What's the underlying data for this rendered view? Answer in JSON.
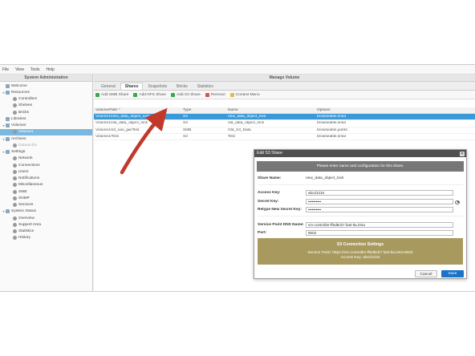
{
  "menu": [
    "File",
    "View",
    "Tools",
    "Help"
  ],
  "sidebar": {
    "title": "System Administration",
    "items": [
      {
        "label": "Welcome",
        "level": 0,
        "tw": ""
      },
      {
        "label": "Resources",
        "level": 0,
        "tw": "▾"
      },
      {
        "label": "Controllers",
        "level": 1,
        "tw": ""
      },
      {
        "label": "Shelves",
        "level": 1,
        "tw": ""
      },
      {
        "label": "Bricks",
        "level": 1,
        "tw": ""
      },
      {
        "label": "Libraries",
        "level": 0,
        "tw": ""
      },
      {
        "label": "Volumes",
        "level": 0,
        "tw": "▾"
      },
      {
        "label": "Volume1",
        "level": 1,
        "tw": "",
        "selected": true
      },
      {
        "label": "Archives",
        "level": 0,
        "tw": "▾"
      },
      {
        "label": "Dataarchiv",
        "level": 1,
        "tw": "",
        "disabled": true
      },
      {
        "label": "Settings",
        "level": 0,
        "tw": "▾"
      },
      {
        "label": "Network",
        "level": 1,
        "tw": ""
      },
      {
        "label": "Connections",
        "level": 1,
        "tw": ""
      },
      {
        "label": "Users",
        "level": 1,
        "tw": ""
      },
      {
        "label": "Notifications",
        "level": 1,
        "tw": ""
      },
      {
        "label": "Miscellaneous",
        "level": 1,
        "tw": ""
      },
      {
        "label": "SMB",
        "level": 1,
        "tw": ""
      },
      {
        "label": "SNMP",
        "level": 1,
        "tw": ""
      },
      {
        "label": "Services",
        "level": 1,
        "tw": ""
      },
      {
        "label": "System Status",
        "level": 0,
        "tw": "▾"
      },
      {
        "label": "Overview",
        "level": 1,
        "tw": ""
      },
      {
        "label": "Support Area",
        "level": 1,
        "tw": ""
      },
      {
        "label": "Statistics",
        "level": 1,
        "tw": ""
      },
      {
        "label": "History",
        "level": 1,
        "tw": ""
      }
    ]
  },
  "main": {
    "title": "Manage Volume",
    "tabs": [
      "General",
      "Shares",
      "Snapshots",
      "Bricks",
      "Statistics"
    ],
    "toolbar": [
      {
        "label": "Add SMB Share",
        "color": "#3aa845"
      },
      {
        "label": "Add NFS Share",
        "color": "#3aa845"
      },
      {
        "label": "Add S3 Share",
        "color": "#3aa845"
      },
      {
        "label": "Remove",
        "color": "#d9534f"
      },
      {
        "label": "Context Menu",
        "color": "#e5b94a"
      }
    ],
    "grid": {
      "headers": [
        "Volume/Path ^",
        "Type",
        "Name",
        "Options"
      ],
      "rows": [
        [
          "Volume1/new_data_object_lock",
          "S3",
          "new_data_object_lock",
          "browseable,snsd"
        ],
        [
          "Volume1/old_data_object_lock",
          "S3",
          "old_data_object_lock",
          "browseable,snsd"
        ],
        [
          "Volume1/s3_nas_gw/Test",
          "SMB",
          "Old_S3_Data",
          "browseable,public"
        ],
        [
          "Volume1/Test",
          "S3",
          "Test",
          "browseable,snsd"
        ]
      ]
    }
  },
  "dialog": {
    "title": "Edit S3 Share",
    "close": "✕",
    "info": "Please enter name and configuration for this share.",
    "share_name_label": "Share Name:",
    "share_name": "new_data_object_lock",
    "access_key_label": "Access Key:",
    "access_key": "abcd1234",
    "secret_key_label": "Secret Key:",
    "secret_key": "••••••••••",
    "retype_label": "Retype New Secret Key:",
    "retype": "••••••••••",
    "dns_label": "Service Point DNS Name:",
    "dns": "vm-controller-ff5d8cb7.fast-lta.intra",
    "port_label": "Port:",
    "port": "9002",
    "conn_title": "S3 Connection Settings",
    "conn_point": "Service Point: https://vm-controller-ff5d8cb7.fast-lta.intra:9002",
    "conn_key": "Access Key: abcd1234",
    "cancel": "Cancel",
    "save": "Save"
  },
  "arrow_color": "#c0392b"
}
